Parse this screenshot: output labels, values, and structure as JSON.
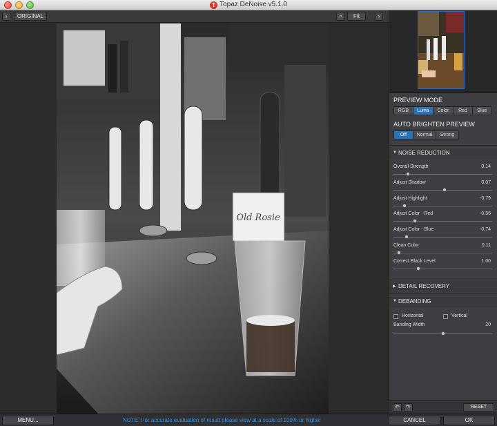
{
  "window": {
    "title": "Topaz DeNoise v5.1.0",
    "logo_letter": "T"
  },
  "toolbar": {
    "left_chevron": "›",
    "original_label": "ORIGINAL",
    "search_icon": "⌕",
    "fit_label": "Fit",
    "right_chevron": "›"
  },
  "preview_mode": {
    "title": "PREVIEW MODE",
    "options": [
      "RGB",
      "Luma",
      "Color",
      "Red",
      "Blue"
    ],
    "selected": "Luma"
  },
  "auto_brighten": {
    "title": "AUTO BRIGHTEN PREVIEW",
    "options": [
      "Off",
      "Normal",
      "Strong"
    ],
    "selected": "Off"
  },
  "noise_reduction": {
    "header": "NOISE REDUCTION",
    "sliders": [
      {
        "label": "Overall Strength",
        "value": "0.14",
        "fraction": 0.15
      },
      {
        "label": "Adjust Shadow",
        "value": "0.07",
        "fraction": 0.52
      },
      {
        "label": "Adjust Highlight",
        "value": "-0.79",
        "fraction": 0.11
      },
      {
        "label": "Adjust Color - Red",
        "value": "-0.56",
        "fraction": 0.22
      },
      {
        "label": "Adjust Color - Blue",
        "value": "-0.74",
        "fraction": 0.13
      },
      {
        "label": "Clean Color",
        "value": "0.11",
        "fraction": 0.055
      },
      {
        "label": "Correct Black Level",
        "value": "1.00",
        "fraction": 0.25
      }
    ]
  },
  "detail_recovery": {
    "header": "DETAIL RECOVERY"
  },
  "debanding": {
    "header": "DEBANDING",
    "horizontal_label": "Horizontal",
    "vertical_label": "Vertical",
    "banding_width_label": "Banding Width",
    "banding_width_value": "20",
    "banding_width_fraction": 0.5
  },
  "panel_footer": {
    "undo_icon": "↶",
    "redo_icon": "↷",
    "reset_label": "RESET"
  },
  "bottom": {
    "menu_label": "MENU...",
    "note": "NOTE:   For accurate evaluation of result please view at a scale of 100% or higher",
    "cancel_label": "CANCEL",
    "ok_label": "OK"
  },
  "colors": {
    "accent": "#2a73b8",
    "note_text": "#3f8fd8"
  }
}
